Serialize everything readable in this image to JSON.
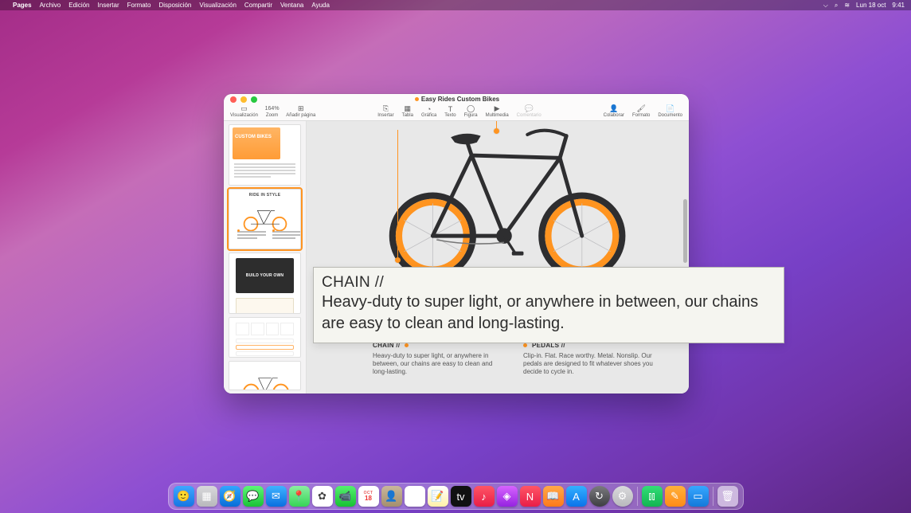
{
  "menubar": {
    "app_name": "Pages",
    "menus": [
      "Archivo",
      "Edición",
      "Insertar",
      "Formato",
      "Disposición",
      "Visualización",
      "Compartir",
      "Ventana",
      "Ayuda"
    ],
    "status": {
      "date": "Lun 18 oct",
      "time": "9:41"
    }
  },
  "window": {
    "title": "Easy Rides Custom Bikes",
    "zoom_label": "164%",
    "toolbar": {
      "visualization": "Visualización",
      "zoom": "Zoom",
      "add_page": "Añadir página",
      "insert": "Insertar",
      "table": "Tabla",
      "chart": "Gráfica",
      "text": "Texto",
      "shape": "Figura",
      "media": "Multimedia",
      "comment": "Comentario",
      "collaborate": "Colaborar",
      "format": "Formato",
      "document": "Documento"
    },
    "thumbnails": {
      "page1_label": "CUSTOM BIKES",
      "page2_label": "RIDE IN STYLE",
      "page3_label": "BUILD YOUR OWN"
    },
    "document": {
      "chain": {
        "heading": "CHAIN //",
        "body": "Heavy-duty to super light, or anywhere in between, our chains are easy to clean and long-lasting."
      },
      "pedals": {
        "heading": "PEDALS //",
        "body": "Clip-in. Flat. Race worthy. Metal. Nonslip. Our pedals are designed to fit whatever shoes you decide to cycle in."
      }
    }
  },
  "hover": {
    "title": "CHAIN //",
    "body": "Heavy-duty to super light, or anywhere in between, our chains are easy to clean and long-lasting."
  },
  "dock": {
    "calendar_month": "OCT",
    "calendar_day": "18"
  }
}
